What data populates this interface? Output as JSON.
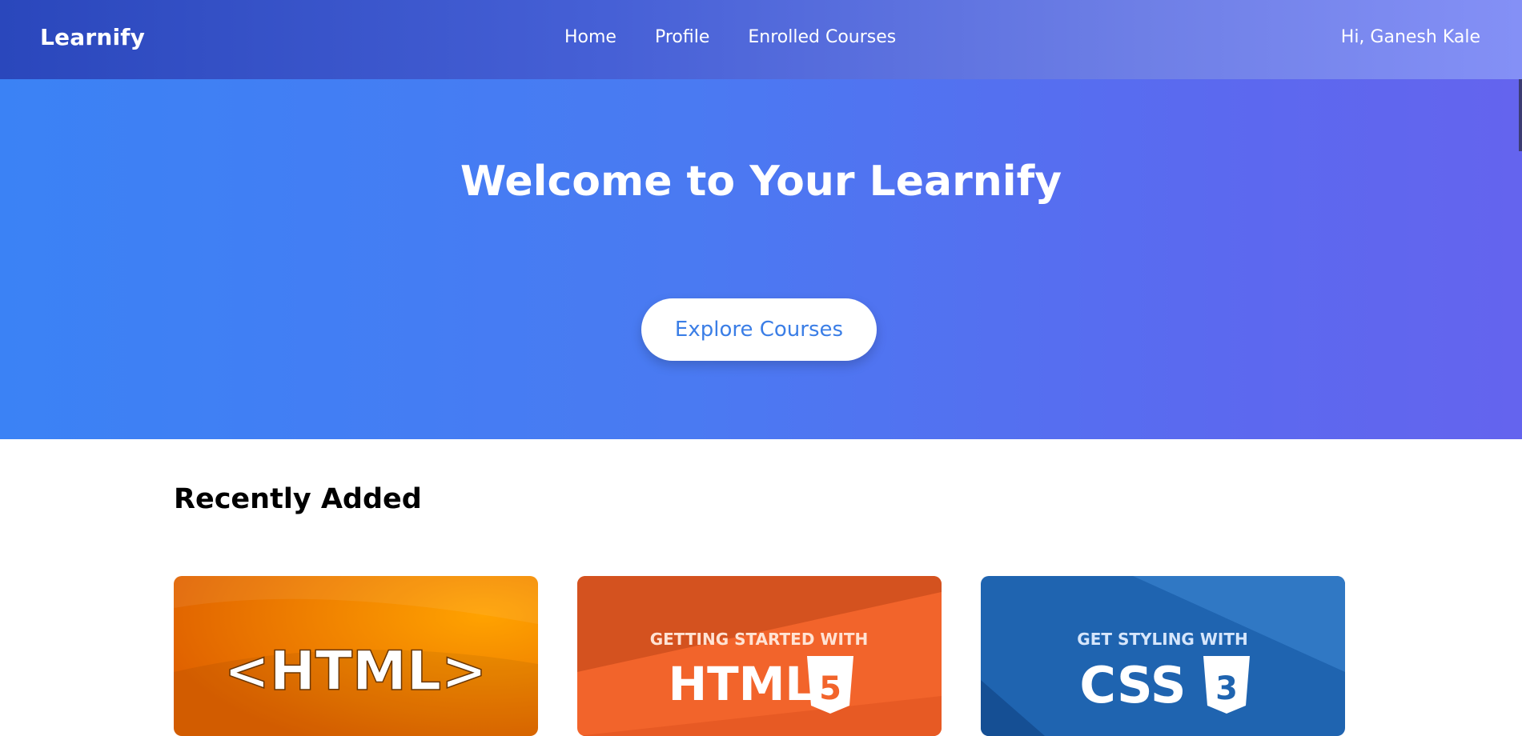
{
  "nav": {
    "brand": "Learnify",
    "links": [
      "Home",
      "Profile",
      "Enrolled Courses"
    ],
    "greeting": "Hi, Ganesh Kale"
  },
  "hero": {
    "title": "Welcome to Your Learnify",
    "cta_label": "Explore Courses"
  },
  "recent": {
    "title": "Recently Added",
    "cards": [
      {
        "image_text": "<HTML>"
      },
      {
        "image_kicker": "GETTING STARTED WITH",
        "image_text": "HTML",
        "badge": "5"
      },
      {
        "image_kicker": "GET STYLING WITH",
        "image_text": "CSS",
        "badge": "3"
      }
    ]
  },
  "colors": {
    "nav_start": "#2a47bc",
    "nav_end": "#8490f6",
    "hero_start": "#3b82f5",
    "hero_end": "#6464ee",
    "cta_text": "#3b7ee6"
  }
}
